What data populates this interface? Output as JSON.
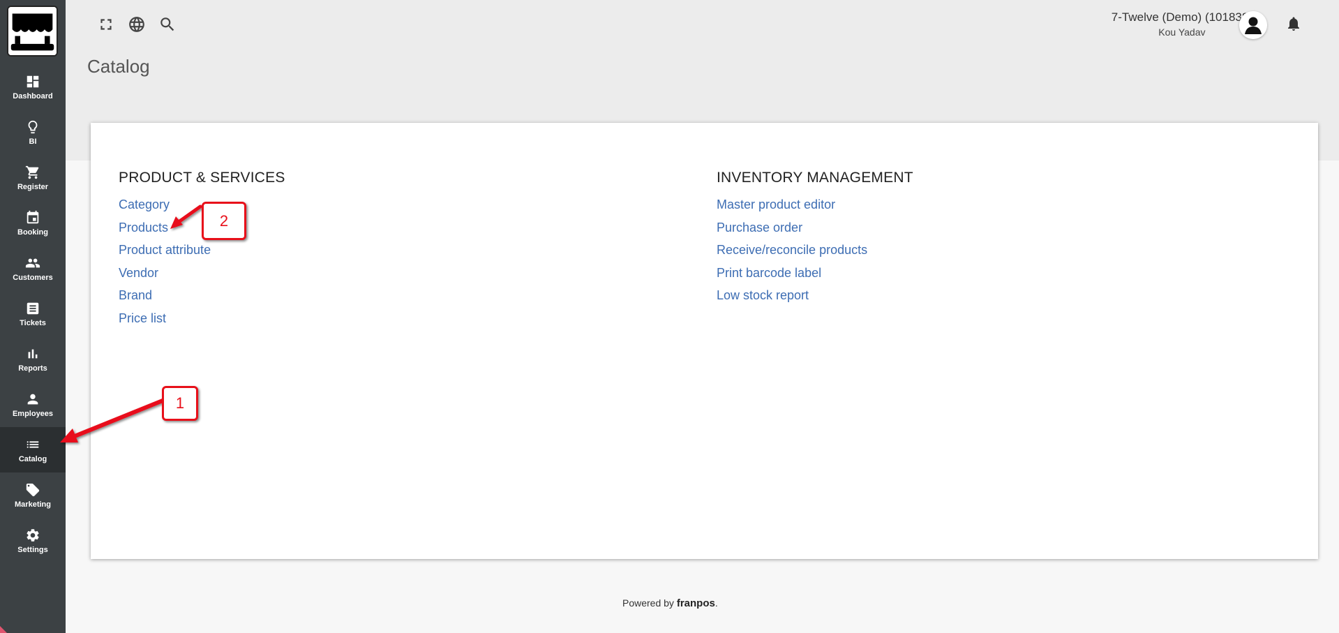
{
  "sidebar": {
    "items": [
      {
        "label": "Dashboard",
        "icon": "dashboard-icon"
      },
      {
        "label": "BI",
        "icon": "lightbulb-icon"
      },
      {
        "label": "Register",
        "icon": "cart-icon"
      },
      {
        "label": "Booking",
        "icon": "calendar-icon"
      },
      {
        "label": "Customers",
        "icon": "people-icon"
      },
      {
        "label": "Tickets",
        "icon": "receipt-icon"
      },
      {
        "label": "Reports",
        "icon": "bar-chart-icon"
      },
      {
        "label": "Employees",
        "icon": "person-icon"
      },
      {
        "label": "Catalog",
        "icon": "list-icon",
        "active": true
      },
      {
        "label": "Marketing",
        "icon": "tag-icon"
      },
      {
        "label": "Settings",
        "icon": "gear-icon"
      }
    ]
  },
  "header": {
    "page_title": "Catalog",
    "org_name": "7-Twelve (Demo) (101838)",
    "user_name": "Kou Yadav"
  },
  "catalog": {
    "product_services": {
      "title": "PRODUCT & SERVICES",
      "links": [
        "Category",
        "Products",
        "Product attribute",
        "Vendor",
        "Brand",
        "Price list"
      ]
    },
    "inventory_management": {
      "title": "INVENTORY MANAGEMENT",
      "links": [
        "Master product editor",
        "Purchase order",
        "Receive/reconcile products",
        "Print barcode label",
        "Low stock report"
      ]
    }
  },
  "footer": {
    "powered_by": "Powered by",
    "brand": "franpos",
    "period": "."
  },
  "annotations": {
    "step1": "1",
    "step2": "2",
    "color": "#e8101a"
  }
}
